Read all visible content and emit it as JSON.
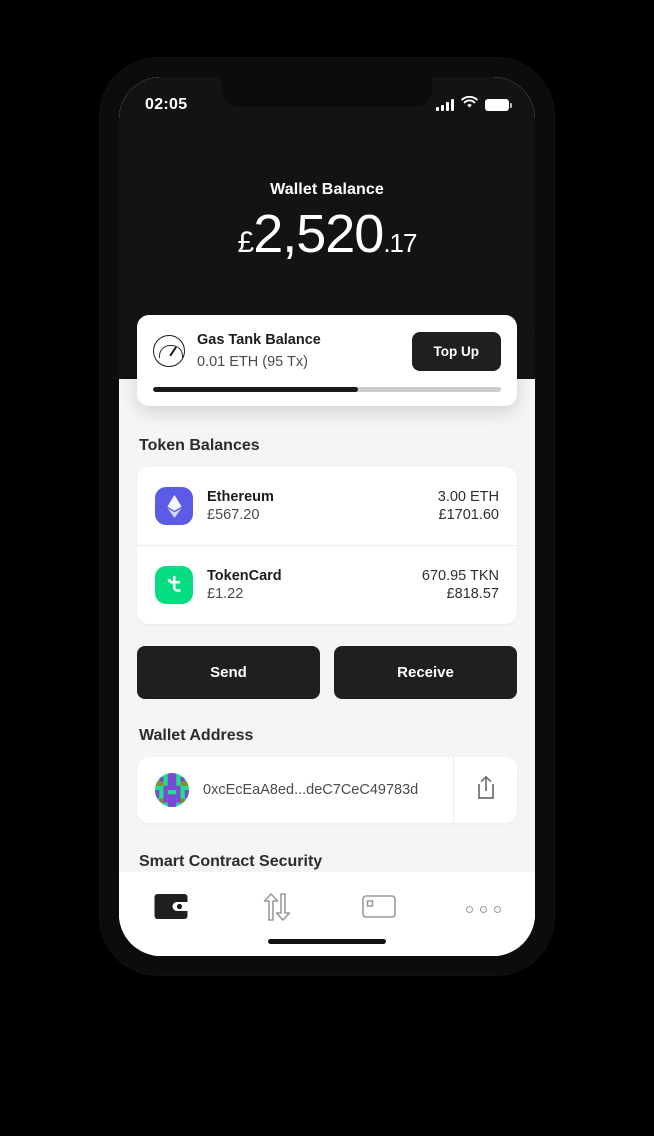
{
  "status_bar": {
    "time": "02:05",
    "cellular_icon": "signal-bars-icon",
    "wifi_icon": "wifi-icon",
    "battery_icon": "battery-icon"
  },
  "header": {
    "balance_label": "Wallet Balance",
    "currency_symbol": "£",
    "balance_integer": "2,520",
    "balance_decimal": ".17"
  },
  "gas_tank": {
    "icon": "gauge-icon",
    "title": "Gas Tank Balance",
    "subtitle": "0.01 ETH (95 Tx)",
    "topup_label": "Top Up",
    "progress_percent": 59
  },
  "token_balances": {
    "section_title": "Token Balances",
    "tokens": [
      {
        "name": "Ethereum",
        "price": "£567.20",
        "quantity": "3.00 ETH",
        "value": "£1701.60",
        "icon": "ethereum-icon",
        "icon_color": "#5b5be6"
      },
      {
        "name": "TokenCard",
        "price": "£1.22",
        "quantity": "670.95 TKN",
        "value": "£818.57",
        "icon": "tokencard-icon",
        "icon_color": "#05de80"
      }
    ]
  },
  "actions": {
    "send_label": "Send",
    "receive_label": "Receive"
  },
  "wallet_address": {
    "section_title": "Wallet Address",
    "avatar_icon": "blockie-avatar",
    "address": "0xcEcEaA8ed...deC7CeC49783d",
    "share_icon": "share-icon"
  },
  "smart_contract_security": {
    "section_title": "Smart Contract Security"
  },
  "bottom_nav": {
    "items": [
      {
        "icon": "wallet-icon",
        "active": true
      },
      {
        "icon": "transfer-arrows-icon",
        "active": false
      },
      {
        "icon": "card-icon",
        "active": false
      },
      {
        "icon": "more-dots-icon",
        "active": false
      }
    ]
  },
  "colors": {
    "header_background": "#131313",
    "body_background": "#f5f5f5",
    "button_dark": "#1f1f1f",
    "progress_fill": "#1a1a1a",
    "progress_track": "#cccccc"
  }
}
